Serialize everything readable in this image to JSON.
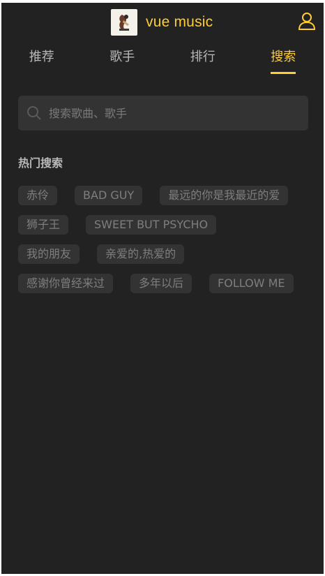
{
  "header": {
    "title": "vue music",
    "logo_icon": "album-cover-logo",
    "user_icon": "user-icon"
  },
  "tabs": [
    {
      "label": "推荐",
      "active": false
    },
    {
      "label": "歌手",
      "active": false
    },
    {
      "label": "排行",
      "active": false
    },
    {
      "label": "搜索",
      "active": true
    }
  ],
  "search": {
    "placeholder": "搜索歌曲、歌手",
    "value": ""
  },
  "hot": {
    "title": "热门搜索",
    "items": [
      "赤伶",
      "BAD GUY",
      "最远的你是我最近的爱",
      "狮子王",
      "SWEET BUT PSYCHO",
      "我的朋友",
      "亲爱的,热爱的",
      "感谢你曾经来过",
      "多年以后",
      "FOLLOW ME"
    ]
  },
  "colors": {
    "background": "#222222",
    "accent": "#ffcd32",
    "chip": "#333333",
    "text_muted": "#7e7e7e"
  }
}
